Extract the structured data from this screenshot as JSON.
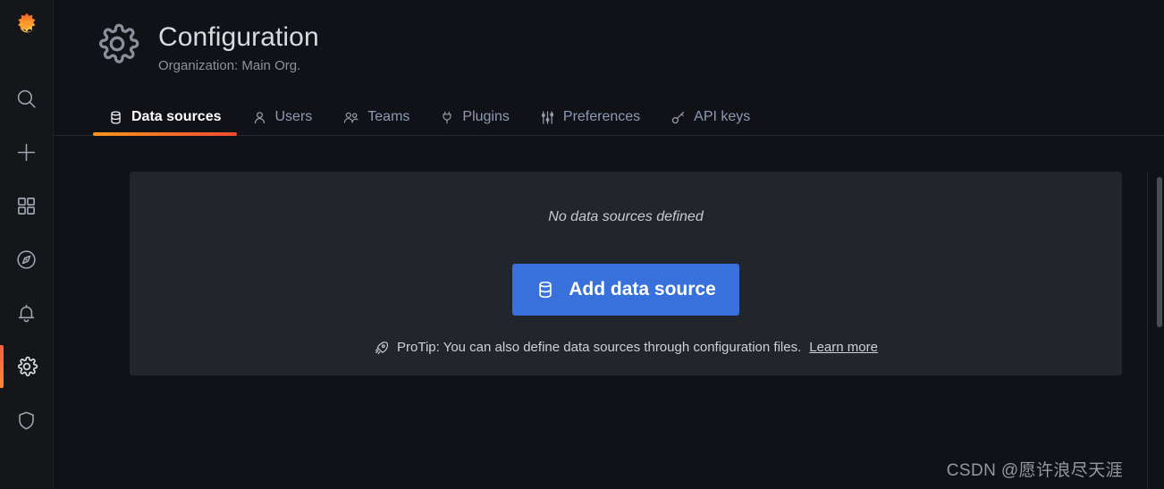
{
  "app": {
    "logo_icon": "grafana-logo-icon",
    "accent_orange": "#f55f3e",
    "accent_orange_light": "#ff8833",
    "button_blue": "#3871dc",
    "page_background": "#111217",
    "card_background": "#22252b",
    "sidebar_background": "#141619"
  },
  "sidebar": {
    "items": [
      {
        "name": "search",
        "icon": "search-icon",
        "active": false
      },
      {
        "name": "create",
        "icon": "plus-icon",
        "active": false
      },
      {
        "name": "dashboards",
        "icon": "apps-grid-icon",
        "active": false
      },
      {
        "name": "explore",
        "icon": "compass-icon",
        "active": false
      },
      {
        "name": "alerting",
        "icon": "bell-icon",
        "active": false
      },
      {
        "name": "configuration",
        "icon": "gear-icon",
        "active": true
      },
      {
        "name": "server-admin",
        "icon": "shield-icon",
        "active": false
      }
    ]
  },
  "header": {
    "icon": "gear-icon",
    "title": "Configuration",
    "subtitle": "Organization: Main Org."
  },
  "tabs": [
    {
      "label": "Data sources",
      "icon": "database-icon",
      "active": true
    },
    {
      "label": "Users",
      "icon": "user-icon",
      "active": false
    },
    {
      "label": "Teams",
      "icon": "users-group-icon",
      "active": false
    },
    {
      "label": "Plugins",
      "icon": "plug-icon",
      "active": false
    },
    {
      "label": "Preferences",
      "icon": "sliders-icon",
      "active": false
    },
    {
      "label": "API keys",
      "icon": "key-icon",
      "active": false
    }
  ],
  "main": {
    "empty_state_title": "No data sources defined",
    "add_button_label": "Add data source",
    "add_button_icon": "database-icon",
    "protip_icon": "rocket-icon",
    "protip_text": "ProTip: You can also define data sources through configuration files.",
    "protip_link_label": "Learn more"
  },
  "watermark": {
    "text": "CSDN @愿许浪尽天涯"
  }
}
